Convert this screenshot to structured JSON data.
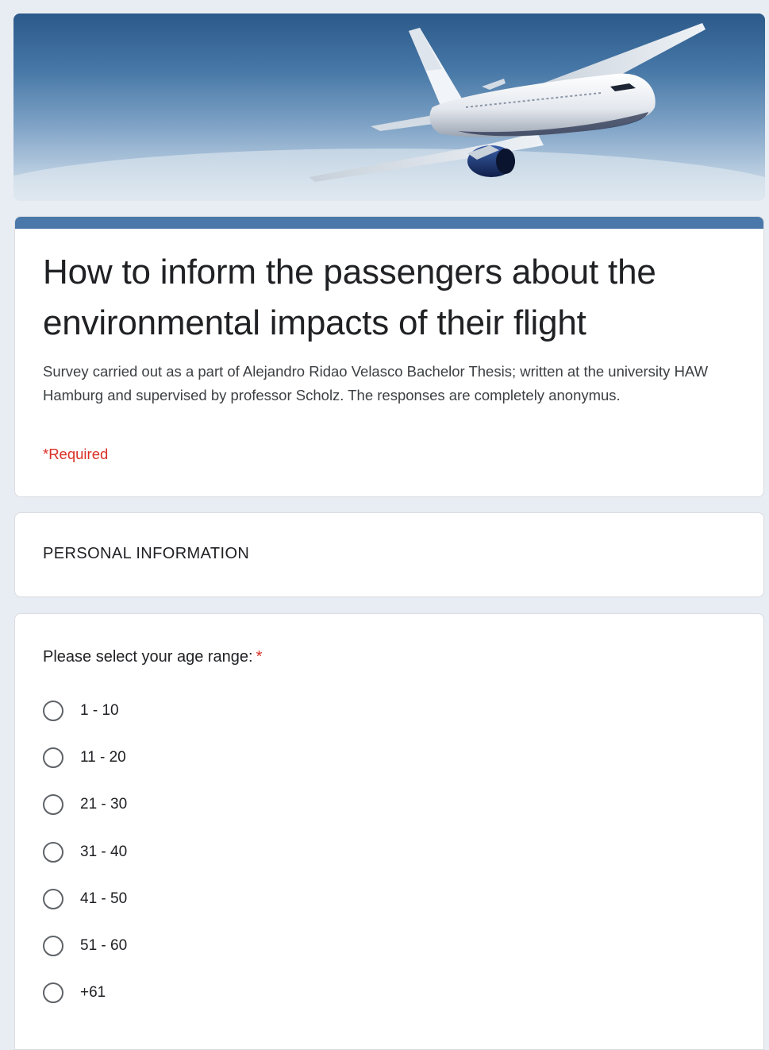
{
  "banner": {
    "image_description": "airplane-banner"
  },
  "form": {
    "title": "How to inform the passengers about the environmental impacts of their flight",
    "description": "Survey carried out as a part of Alejandro Ridao Velasco Bachelor Thesis; written at the university HAW Hamburg and supervised by professor Scholz. The responses are completely anonymus.",
    "required_note": "*Required"
  },
  "section": {
    "title": "PERSONAL INFORMATION"
  },
  "question": {
    "label": "Please select your age range:",
    "required_marker": "*",
    "options": [
      {
        "label": "1 - 10"
      },
      {
        "label": "11 - 20"
      },
      {
        "label": "21 - 30"
      },
      {
        "label": "31 - 40"
      },
      {
        "label": "41 - 50"
      },
      {
        "label": "51 - 60"
      },
      {
        "label": "+61"
      }
    ]
  },
  "colors": {
    "accent": "#4a78ab",
    "required": "#d93025",
    "background": "#e8edf3"
  }
}
